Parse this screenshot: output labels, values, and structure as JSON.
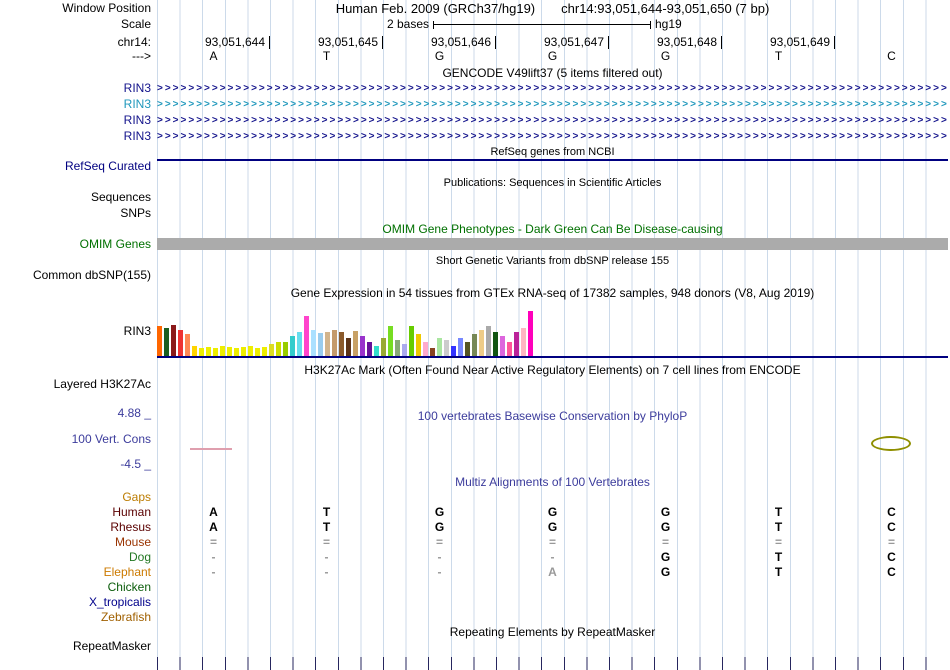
{
  "colors": {
    "grid_line": "#ccdaea",
    "tick_dark": "#26265e",
    "navy": "#000080",
    "gencode_blue": "#14148c",
    "gencode_teal": "#2098bc",
    "omim_green": "#007000",
    "cons_blue": "#3c3c9c",
    "omim_bar_gray": "#ababab",
    "dim_gray": "#999999",
    "pink_mark": "#df9fae",
    "olive_mark": "#8f8f00"
  },
  "header": {
    "window_position_label": "Window Position",
    "assembly": "Human Feb. 2009 (GRCh37/hg19)",
    "position": "chr14:93,051,644-93,051,650 (7 bp)",
    "scale_label": "Scale",
    "scale_value": "2 bases",
    "scale_assembly": "hg19",
    "chrom_label": "chr14:",
    "ruler_coords": [
      "93,051,644",
      "93,051,645",
      "93,051,646",
      "93,051,647",
      "93,051,648",
      "93,051,649"
    ],
    "strand_label": "--->",
    "bases": [
      "A",
      "T",
      "G",
      "G",
      "G",
      "T",
      "C"
    ]
  },
  "tracks": {
    "gencode": {
      "title": "GENCODE V49lift37 (5 items filtered out)",
      "items": [
        {
          "label": "RIN3",
          "color": "#14148c"
        },
        {
          "label": "RIN3",
          "color": "#2098bc"
        },
        {
          "label": "RIN3",
          "color": "#14148c"
        },
        {
          "label": "RIN3",
          "color": "#14148c"
        }
      ]
    },
    "refseq": {
      "title": "RefSeq genes from NCBI",
      "label": "RefSeq Curated"
    },
    "publications": {
      "title": "Publications: Sequences in Scientific Articles",
      "label_sequences": "Sequences",
      "label_snps": "SNPs"
    },
    "omim": {
      "title": "OMIM Gene Phenotypes - Dark Green Can Be Disease-causing",
      "label": "OMIM Genes"
    },
    "dbsnp": {
      "title": "Short Genetic Variants from dbSNP release 155",
      "label": "Common dbSNP(155)"
    },
    "gtex": {
      "label": "RIN3"
    },
    "h3k27ac": {
      "title": "H3K27Ac Mark (Often Found Near Active Regulatory Elements) on 7 cell lines from ENCODE",
      "label": "Layered H3K27Ac"
    },
    "conservation": {
      "title": "100 vertebrates Basewise Conservation by PhyloP",
      "label": "100 Vert. Cons",
      "max": "4.88 _",
      "min": "-4.5 _"
    },
    "multiz": {
      "title": "Multiz Alignments of 100 Vertebrates",
      "rows": [
        {
          "label": "Gaps",
          "color": "#bc7c00",
          "cells": [
            "",
            "",
            "",
            "",
            "",
            "",
            ""
          ]
        },
        {
          "label": "Human",
          "color": "#5a0000",
          "cells": [
            "A",
            "T",
            "G",
            "G",
            "G",
            "T",
            "C"
          ]
        },
        {
          "label": "Rhesus",
          "color": "#5a0000",
          "cells": [
            "A",
            "T",
            "G",
            "G",
            "G",
            "T",
            "C"
          ]
        },
        {
          "label": "Mouse",
          "color": "#993300",
          "cells": [
            "=",
            "=",
            "=",
            "=",
            "=",
            "=",
            "="
          ]
        },
        {
          "label": "Dog",
          "color": "#227722",
          "cells": [
            "-",
            "-",
            "-",
            "-",
            "G",
            "T",
            "C"
          ]
        },
        {
          "label": "Elephant",
          "color": "#cc7a00",
          "cells": [
            "-",
            "-",
            "-",
            "A",
            "G",
            "T",
            "C"
          ],
          "dim": [
            3
          ]
        },
        {
          "label": "Chicken",
          "color": "#0a5c0a",
          "cells": [
            "",
            "",
            "",
            "",
            "",
            "",
            ""
          ]
        },
        {
          "label": "X_tropicalis",
          "color": "#00008b",
          "cells": [
            "",
            "",
            "",
            "",
            "",
            "",
            ""
          ]
        },
        {
          "label": "Zebrafish",
          "color": "#a06000",
          "cells": [
            "",
            "",
            "",
            "",
            "",
            "",
            ""
          ]
        }
      ]
    },
    "repeatmasker": {
      "title": "Repeating Elements by RepeatMasker",
      "label": "RepeatMasker"
    }
  },
  "chart_data": {
    "type": "bar",
    "title": "Gene Expression in 54 tissues from GTEx RNA-seq of 17382 samples, 948 donors (V8, Aug 2019)",
    "series_name": "RIN3 expression",
    "values": [
      30,
      28,
      31,
      26,
      22,
      10,
      8,
      9,
      8,
      10,
      9,
      8,
      9,
      10,
      8,
      9,
      12,
      14,
      14,
      20,
      24,
      40,
      26,
      23,
      24,
      26,
      24,
      18,
      25,
      20,
      14,
      10,
      18,
      30,
      16,
      12,
      30,
      22,
      14,
      8,
      18,
      16,
      10,
      18,
      14,
      22,
      26,
      30,
      24,
      20,
      14,
      24,
      28,
      45
    ],
    "bar_colors": [
      "#FF6600",
      "#1B5E20",
      "#8B1A1A",
      "#EE3333",
      "#FF8855",
      "#FFD400",
      "#EEEE00",
      "#EEEE00",
      "#EEEE00",
      "#EEEE00",
      "#EEEE00",
      "#EEEE00",
      "#EEEE00",
      "#EEEE00",
      "#EEEE00",
      "#EEEE00",
      "#DDDD22",
      "#CCDD00",
      "#99CC00",
      "#33CCCC",
      "#66DDEE",
      "#FF44CC",
      "#AAE0FF",
      "#99CCEE",
      "#D2B48C",
      "#C49A6C",
      "#8B5A2B",
      "#5C3317",
      "#C8A165",
      "#9933CC",
      "#661199",
      "#33DDCC",
      "#99AA33",
      "#77DD22",
      "#88AA77",
      "#AAAAEE",
      "#66CC00",
      "#EEC900",
      "#FFAACC",
      "#884422",
      "#AAE6A0",
      "#CCCCCC",
      "#3333FF",
      "#7788FF",
      "#555522",
      "#778855",
      "#EECC88",
      "#AAAAAA",
      "#115511",
      "#DD66DD",
      "#FF5599",
      "#BB2299",
      "#FFB6C1",
      "#FF00BB"
    ],
    "ylim": [
      0,
      50
    ],
    "legend": "off",
    "grid": "off"
  }
}
